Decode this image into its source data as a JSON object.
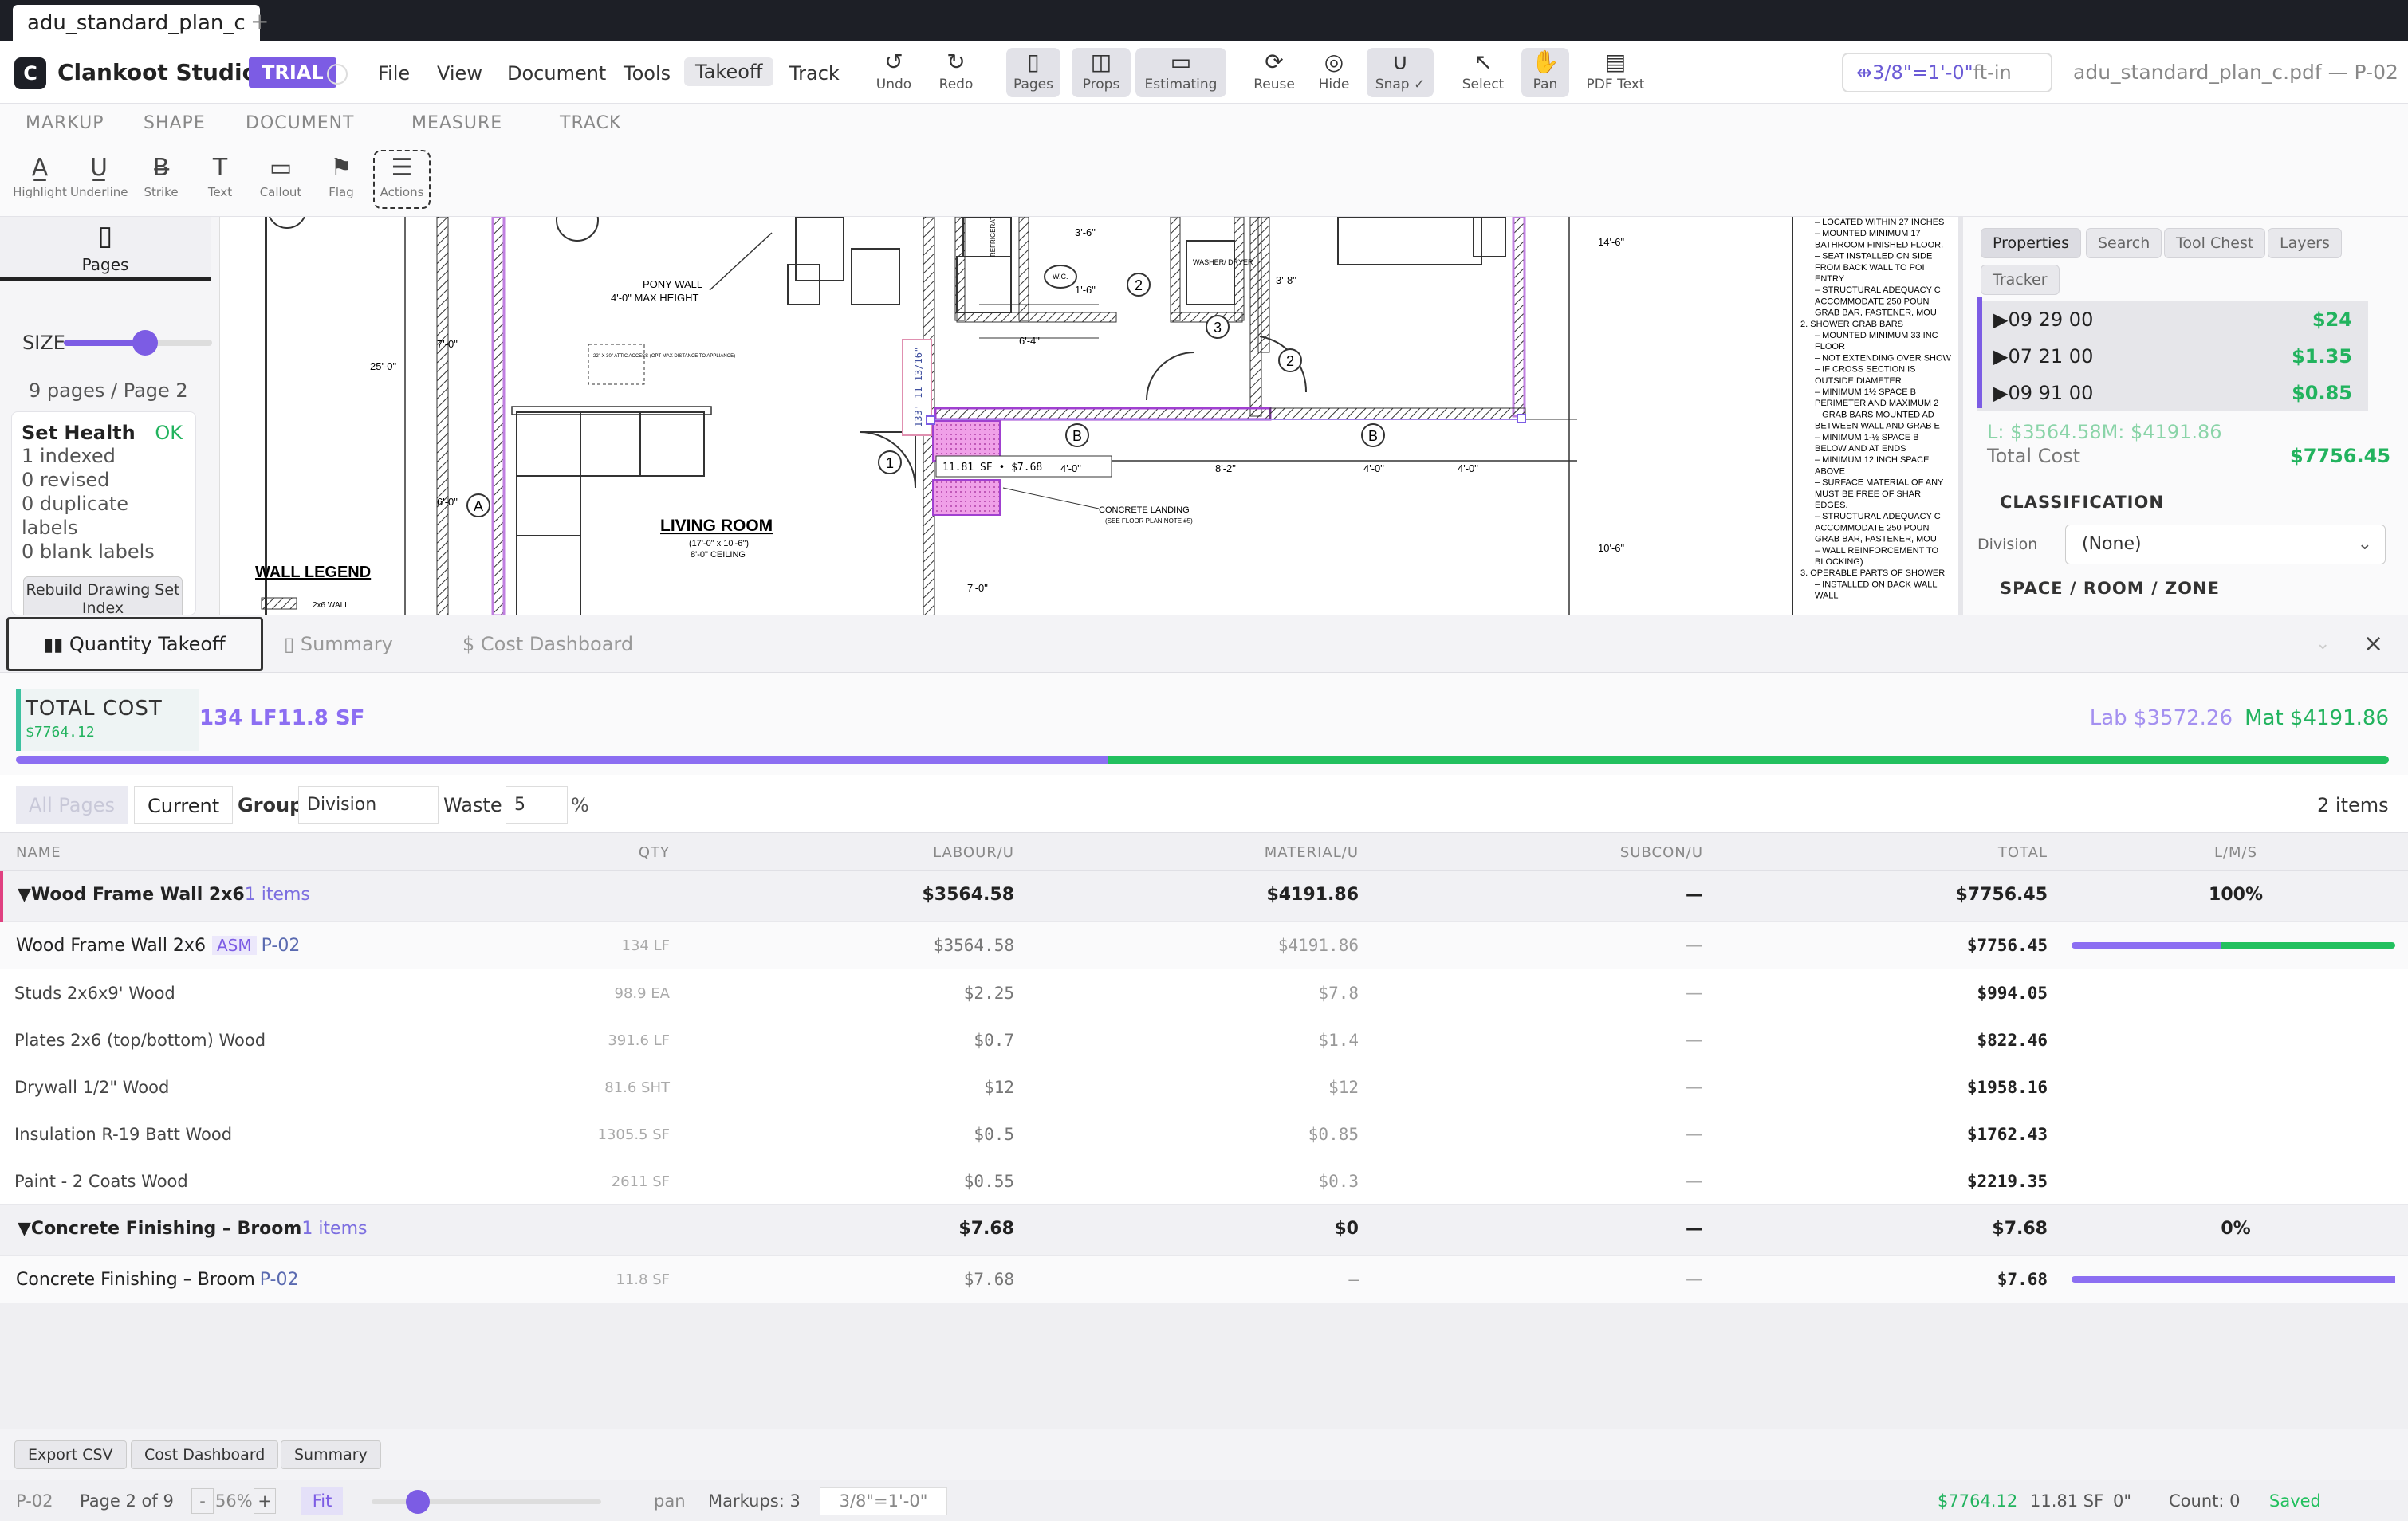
{
  "tab": {
    "title": "adu_standard_plan_c",
    "new_tab": "+"
  },
  "app": {
    "logo_letter": "C",
    "name": "Clankoot Studio",
    "badge": "TRIAL",
    "accent": "#7c5ce4"
  },
  "menu": [
    "File",
    "View",
    "Document",
    "Tools",
    "Takeoff",
    "Track"
  ],
  "menu_active": "Takeoff",
  "toolbar": [
    {
      "label": "Undo",
      "icon": "undo-icon",
      "glyph": "↺"
    },
    {
      "label": "Redo",
      "icon": "redo-icon",
      "glyph": "↻"
    },
    {
      "label": "Pages",
      "icon": "pages-icon",
      "glyph": "▯"
    },
    {
      "label": "Props",
      "icon": "props-icon",
      "glyph": "◫"
    },
    {
      "label": "Estimating",
      "icon": "estimating-icon",
      "glyph": "▭"
    },
    {
      "label": "Reuse",
      "icon": "reuse-icon",
      "glyph": "⟳"
    },
    {
      "label": "Hide",
      "icon": "eye-off-icon",
      "glyph": "◎"
    },
    {
      "label": "Snap ✓",
      "icon": "magnet-icon",
      "glyph": "∪"
    },
    {
      "label": "Select",
      "icon": "cursor-icon",
      "glyph": "↖"
    },
    {
      "label": "Pan",
      "icon": "hand-icon",
      "glyph": "✋"
    },
    {
      "label": "PDF Text",
      "icon": "pdf-text-icon",
      "glyph": "▤"
    }
  ],
  "scale": {
    "value": "3/8\"=1'-0\"",
    "unit": "ft-in",
    "icon": "arrows-icon",
    "glyph": "⇹"
  },
  "file_label": "adu_standard_plan_c.pdf — P-02",
  "ribbon_tabs": [
    "MARKUP",
    "SHAPE",
    "DOCUMENT",
    "MEASURE",
    "TRACK"
  ],
  "markup_tools": [
    {
      "label": "Highlight",
      "glyph": "A̲"
    },
    {
      "label": "Underline",
      "glyph": "U̲"
    },
    {
      "label": "Strike",
      "glyph": "B̶"
    },
    {
      "label": "Text",
      "glyph": "T"
    },
    {
      "label": "Callout",
      "glyph": "▭"
    },
    {
      "label": "Flag",
      "glyph": "⚑"
    },
    {
      "label": "Actions",
      "glyph": "☰"
    }
  ],
  "left_panel": {
    "pages_tab": "Pages",
    "size_label": "SIZE",
    "size_value": 0.55,
    "page_count": "9 pages / Page 2",
    "health": {
      "title": "Set Health",
      "status": "OK",
      "lines": [
        "1 indexed",
        "0 revised",
        "0 duplicate labels",
        "0 blank labels"
      ],
      "rebuild": "Rebuild Drawing Set Index"
    }
  },
  "drawing": {
    "labels": {
      "pony_wall": "PONY WALL",
      "pony_height": "4'-0\" MAX HEIGHT",
      "living_room": "LIVING ROOM",
      "living_dims": "(17'-0\" x 10'-6\")",
      "living_ceiling": "8'-0\" CEILING",
      "wall_legend": "WALL LEGEND",
      "wall_2x6": "2x6 WALL",
      "concrete_landing": "CONCRETE LANDING",
      "concrete_note": "(SEE FLOOR PLAN NOTE #5)",
      "attic": "22\" X 30\" ATTIC ACCESS (OPT MAX DISTANCE TO APPLIANCE)",
      "washer": "WASHER/ DRYER",
      "wc": "W.C.",
      "refrigerator": "REFRIGERATOR",
      "measure_tag": "11.81 SF • $7.68",
      "measure_vert": "133'-11 13/16\""
    },
    "dims": [
      "25'-0\"",
      "7'-0\"",
      "6'-0\"",
      "3'-6\"",
      "1'-6\"",
      "6'-4\"",
      "3'-8\"",
      "14'-6\"",
      "10'-6\"",
      "4'-0\"",
      "8'-2\"",
      "4'-0\"",
      "4'-0\"",
      "7'-0\""
    ],
    "tags": [
      "1",
      "2",
      "2",
      "3",
      "A",
      "B",
      "B"
    ],
    "notes": [
      "– LOCATED WITHIN 27 INCHES",
      "– MOUNTED MINIMUM 17",
      "  BATHROOM FINISHED FLOOR.",
      "– SEAT INSTALLED ON SIDE",
      "  FROM BACK WALL TO POI",
      "  ENTRY",
      "– STRUCTURAL ADEQUACY C",
      "  ACCOMMODATE 250 POUN",
      "  GRAB BAR, FASTENER, MOU",
      "2. SHOWER GRAB BARS",
      "– MOUNTED MINIMUM 33 INC",
      "  FLOOR",
      "– NOT EXTENDING OVER SHOW",
      "– IF CROSS SECTION IS",
      "  OUTSIDE DIAMETER",
      "– MINIMUM 1½ SPACE B",
      "  PERIMETER AND MAXIMUM 2",
      "– GRAB BARS MOUNTED AD",
      "  BETWEEN WALL AND GRAB E",
      "– MINIMUM 1-½ SPACE B",
      "  BELOW AND AT ENDS",
      "– MINIMUM 12 INCH SPACE",
      "  ABOVE",
      "– SURFACE MATERIAL OF ANY",
      "  MUST BE FREE OF SHAR",
      "  EDGES.",
      "– STRUCTURAL ADEQUACY C",
      "  ACCOMMODATE 250 POUN",
      "  GRAB BAR, FASTENER, MOU",
      "– WALL REINFORCEMENT TO",
      "  BLOCKING)",
      "3. OPERABLE PARTS OF SHOWER",
      "– INSTALLED ON BACK WALL",
      "  WALL"
    ]
  },
  "right_panel": {
    "tabs": [
      "Properties",
      "Search",
      "Tool Chest",
      "Layers",
      "Tracker"
    ],
    "cost_codes": [
      {
        "code": "▶09 29 00",
        "amount": "$24"
      },
      {
        "code": "▶07 21 00",
        "amount": "$1.35"
      },
      {
        "code": "▶09 91 00",
        "amount": "$0.85"
      }
    ],
    "lm_line": "L: $3564.58M: $4191.86",
    "total_label": "Total Cost",
    "total_value": "$7756.45",
    "classification": "CLASSIFICATION",
    "division_label": "Division",
    "division_value": "(None)",
    "space_label": "SPACE / ROOM / ZONE"
  },
  "dock": {
    "tabs": [
      "Quantity Takeoff",
      "Summary",
      "Cost Dashboard"
    ],
    "close": "×"
  },
  "totals": {
    "label": "TOTAL COST",
    "value": "$7764.12",
    "qty": "134 LF11.8 SF",
    "lab": "Lab $3572.26",
    "mat": "Mat $4191.86",
    "lab_fraction": 0.46
  },
  "filters": {
    "all_pages": "All Pages",
    "current": "Current",
    "group_label": "Group",
    "group_value": "Division",
    "waste_label": "Waste",
    "waste_value": "5",
    "waste_unit": "%",
    "items_count": "2 items"
  },
  "table": {
    "headers": [
      "NAME",
      "QTY",
      "LABOUR/U",
      "MATERIAL/U",
      "SUBCON/U",
      "TOTAL",
      "L/M/S"
    ],
    "groups": [
      {
        "name": "▼Wood Frame Wall 2x6",
        "count": "1 items",
        "labour": "$3564.58",
        "material": "$4191.86",
        "subcon": "—",
        "total": "$7756.45",
        "lms": "100%",
        "assembly": {
          "name": "Wood Frame Wall 2x6",
          "tag": "ASM",
          "page": "P-02",
          "qty": "134 LF",
          "labour": "$3564.58",
          "material": "$4191.86",
          "subcon": "—",
          "total": "$7756.45",
          "lab_fraction": 0.46
        },
        "items": [
          {
            "name": "Studs 2x6x9' Wood",
            "qty": "98.9 EA",
            "labour": "$2.25",
            "material": "$7.8",
            "subcon": "—",
            "total": "$994.05"
          },
          {
            "name": "Plates 2x6 (top/bottom) Wood",
            "qty": "391.6 LF",
            "labour": "$0.7",
            "material": "$1.4",
            "subcon": "—",
            "total": "$822.46"
          },
          {
            "name": "Drywall 1/2\" Wood",
            "qty": "81.6 SHT",
            "labour": "$12",
            "material": "$12",
            "subcon": "—",
            "total": "$1958.16"
          },
          {
            "name": "Insulation R-19 Batt Wood",
            "qty": "1305.5 SF",
            "labour": "$0.5",
            "material": "$0.85",
            "subcon": "—",
            "total": "$1762.43"
          },
          {
            "name": "Paint - 2 Coats Wood",
            "qty": "2611 SF",
            "labour": "$0.55",
            "material": "$0.3",
            "subcon": "—",
            "total": "$2219.35"
          }
        ]
      },
      {
        "name": "▼Concrete Finishing – Broom",
        "count": "1 items",
        "labour": "$7.68",
        "material": "$0",
        "subcon": "—",
        "total": "$7.68",
        "lms": "0%",
        "assembly": {
          "name": "Concrete Finishing – Broom",
          "tag": "",
          "page": "P-02",
          "qty": "11.8 SF",
          "labour": "$7.68",
          "material": "—",
          "subcon": "—",
          "total": "$7.68",
          "lab_fraction": 1.0
        },
        "items": []
      }
    ]
  },
  "footer_buttons": [
    "Export CSV",
    "Cost Dashboard",
    "Summary"
  ],
  "status": {
    "page": "P-02",
    "page_of": "Page 2 of 9",
    "zoom": "56%",
    "zoom_minus": "-",
    "zoom_plus": "+",
    "fit": "Fit",
    "zoom_fraction": 0.2,
    "mode": "pan",
    "markups": "Markups: 3",
    "scale": "3/8\"=1'-0\"",
    "cost": "$7764.12",
    "area": "11.81 SF",
    "len": "0\"",
    "count": "Count: 0",
    "saved": "Saved"
  }
}
